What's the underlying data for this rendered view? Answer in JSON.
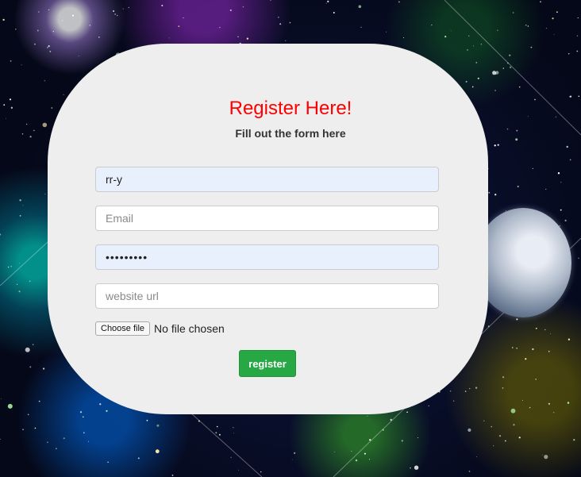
{
  "header": {
    "title": "Register Here!",
    "subtitle": "Fill out the form here"
  },
  "form": {
    "username": {
      "value": "rr-y",
      "placeholder": ""
    },
    "email": {
      "value": "",
      "placeholder": "Email"
    },
    "password": {
      "value": "•••••••••",
      "placeholder": ""
    },
    "website": {
      "value": "",
      "placeholder": "website url"
    },
    "file": {
      "button_label": "Choose file",
      "status": "No file chosen"
    },
    "submit_label": "register"
  },
  "colors": {
    "title": "#ff0000",
    "button": "#28a745",
    "card": "#eeeeee",
    "autofill": "#e8f0fe"
  }
}
